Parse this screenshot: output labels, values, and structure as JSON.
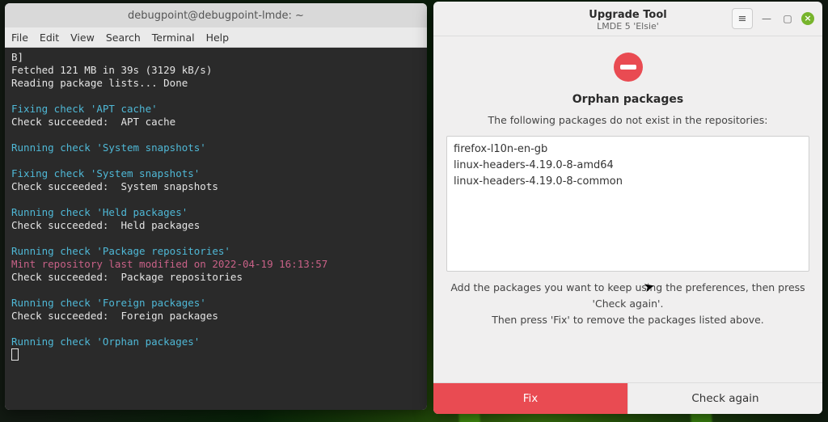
{
  "terminal": {
    "title": "debugpoint@debugpoint-lmde: ~",
    "menu": {
      "file": "File",
      "edit": "Edit",
      "view": "View",
      "search": "Search",
      "terminal": "Terminal",
      "help": "Help"
    },
    "lines": {
      "l0": "B]",
      "l1": "Fetched 121 MB in 39s (3129 kB/s)",
      "l2": "Reading package lists... Done",
      "l3": "",
      "l4": "Fixing check 'APT cache'",
      "l5": "Check succeeded:  APT cache",
      "l6": "",
      "l7": "Running check 'System snapshots'",
      "l8": "",
      "l9": "Fixing check 'System snapshots'",
      "l10": "Check succeeded:  System snapshots",
      "l11": "",
      "l12": "Running check 'Held packages'",
      "l13": "Check succeeded:  Held packages",
      "l14": "",
      "l15": "Running check 'Package repositories'",
      "l16": "Mint repository last modified on 2022-04-19 16:13:57",
      "l17": "Check succeeded:  Package repositories",
      "l18": "",
      "l19": "Running check 'Foreign packages'",
      "l20": "Check succeeded:  Foreign packages",
      "l21": "",
      "l22": "Running check 'Orphan packages'"
    }
  },
  "upgrade": {
    "title": "Upgrade Tool",
    "subtitle": "LMDE 5 'Elsie'",
    "heading": "Orphan packages",
    "subtext": "The following packages do not exist in the repositories:",
    "packages": {
      "p0": "firefox-l10n-en-gb",
      "p1": "linux-headers-4.19.0-8-amd64",
      "p2": "linux-headers-4.19.0-8-common"
    },
    "hint1": "Add the packages you want to keep using the preferences, then press 'Check again'.",
    "hint2": "Then press 'Fix' to remove the packages listed above.",
    "fix": "Fix",
    "check": "Check again"
  }
}
